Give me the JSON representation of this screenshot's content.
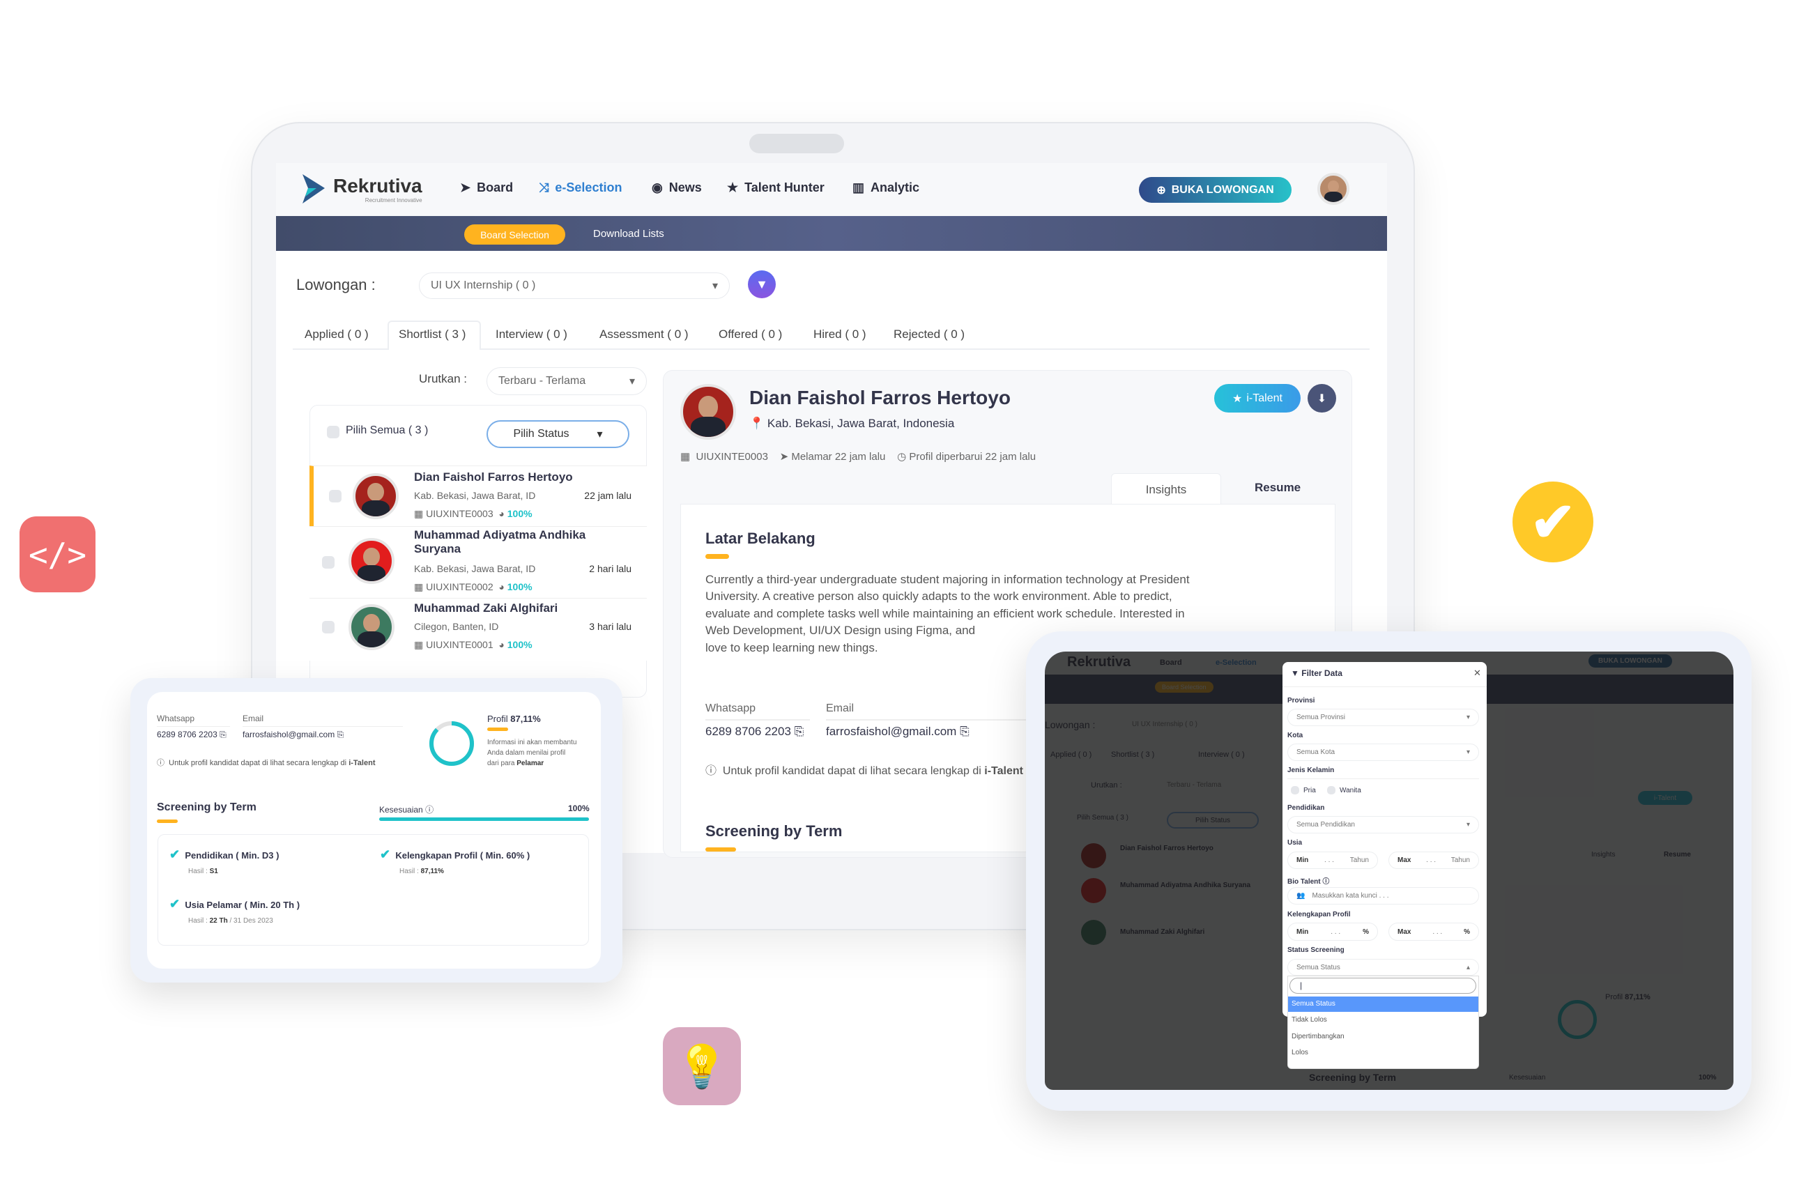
{
  "app": {
    "brand": "Rekrutiva",
    "tagline": "Recruitment Innovative"
  },
  "nav": {
    "items": [
      {
        "label": "Board",
        "icon": "paper-plane-icon"
      },
      {
        "label": "e-Selection",
        "icon": "shuffle-icon",
        "active": true
      },
      {
        "label": "News",
        "icon": "podcast-icon"
      },
      {
        "label": "Talent Hunter",
        "icon": "star-icon"
      },
      {
        "label": "Analytic",
        "icon": "chart-bar-icon"
      }
    ],
    "cta": "BUKA LOWONGAN"
  },
  "subnav": {
    "board_selection": "Board Selection",
    "download_lists": "Download Lists"
  },
  "lowongan": {
    "label": "Lowongan :",
    "value": "UI UX Internship ( 0 )"
  },
  "tabs": [
    "Applied ( 0 )",
    "Shortlist ( 3 )",
    "Interview ( 0 )",
    "Assessment ( 0 )",
    "Offered ( 0 )",
    "Hired ( 0 )",
    "Rejected ( 0 )"
  ],
  "sort": {
    "label": "Urutkan :",
    "value": "Terbaru - Terlama"
  },
  "list": {
    "select_all": "Pilih Semua ( 3 )",
    "status_button": "Pilih Status",
    "candidates": [
      {
        "name": "Dian Faishol Farros Hertoyo",
        "location": "Kab. Bekasi, Jawa Barat, ID",
        "time": "22 jam lalu",
        "code": "UIUXINTE0003",
        "score": "100%"
      },
      {
        "name": "Muhammad Adiyatma Andhika Suryana",
        "location": "Kab. Bekasi, Jawa Barat, ID",
        "time": "2 hari lalu",
        "code": "UIUXINTE0002",
        "score": "100%"
      },
      {
        "name": "Muhammad Zaki Alghifari",
        "location": "Cilegon, Banten, ID",
        "time": "3 hari lalu",
        "code": "UIUXINTE0001",
        "score": "100%"
      }
    ]
  },
  "profile": {
    "name": "Dian Faishol Farros Hertoyo",
    "location": "Kab. Bekasi, Jawa Barat, Indonesia",
    "code": "UIUXINTE0003",
    "applied": "Melamar 22 jam lalu",
    "updated": "Profil diperbarui 22 jam lalu",
    "italent": "i-Talent",
    "tabs": [
      "Insights",
      "Resume"
    ],
    "bg_title": "Latar Belakang",
    "bg_lines": [
      "Currently a third-year undergraduate student majoring in information technology at President",
      "University. A creative person also quickly adapts to the work environment. Able to predict,",
      "evaluate and complete tasks well while maintaining an efficient work schedule. Interested in",
      "Web Development, UI/UX Design using Figma, and",
      "love to keep learning new things."
    ],
    "whatsapp_label": "Whatsapp",
    "whatsapp": "6289 8706 2203",
    "email_label": "Email",
    "email": "farrosfaishol@gmail.com",
    "info": "Untuk profil kandidat dapat di lihat secara lengkap di",
    "info_link": "i-Talent",
    "screening_title": "Screening by Term",
    "kesesuaian": "Kesesuaian",
    "kesesuaian_value": "100%",
    "kesesuaian_pct": 100,
    "profil_label": "Profil",
    "profil_value": "87,11%",
    "profil_pct": 87.11,
    "profil_info": [
      "Informasi ini akan membantu",
      "Anda dalam menilai profil",
      "dari para"
    ],
    "profil_info_bold": "Pelamar",
    "criteria": [
      {
        "title": "Pendidikan ( Min. D3 )",
        "hasil_label": "Hasil :",
        "hasil": "S1"
      },
      {
        "title": "Kelengkapan Profil ( Min. 60% )",
        "hasil_label": "Hasil :",
        "hasil": "87,11%"
      },
      {
        "title": "Usia Pelamar ( Min. 20 Th )",
        "hasil_label": "Hasil :",
        "hasil": "22 Th",
        "hasil_extra": "/ 31 Des 2023"
      }
    ]
  },
  "filter": {
    "title": "Filter Data",
    "provinsi": "Provinsi",
    "provinsi_value": "Semua Provinsi",
    "kota": "Kota",
    "kota_value": "Semua Kota",
    "gender": "Jenis Kelamin",
    "pria": "Pria",
    "wanita": "Wanita",
    "pendidikan": "Pendidikan",
    "pendidikan_value": "Semua Pendidikan",
    "usia": "Usia",
    "min": "Min",
    "max": "Max",
    "dots": ". . .",
    "tahun": "Tahun",
    "bio": "Bio Talent",
    "bio_placeholder": "Masukkan kata kunci . . .",
    "kelengkapan": "Kelengkapan Profil",
    "pct": "%",
    "status": "Status Screening",
    "status_value": "Semua Status",
    "options": [
      "Semua Status",
      "Tidak Lolos",
      "Dipertimbangkan",
      "Lolos"
    ]
  },
  "colors": {
    "accent": "#1fc2c9",
    "orange": "#ffb31f",
    "navy": "#454f70",
    "code_icon": "#f07070",
    "check_badge": "#ffc928",
    "bulb_badge": "#d9a9c0"
  }
}
